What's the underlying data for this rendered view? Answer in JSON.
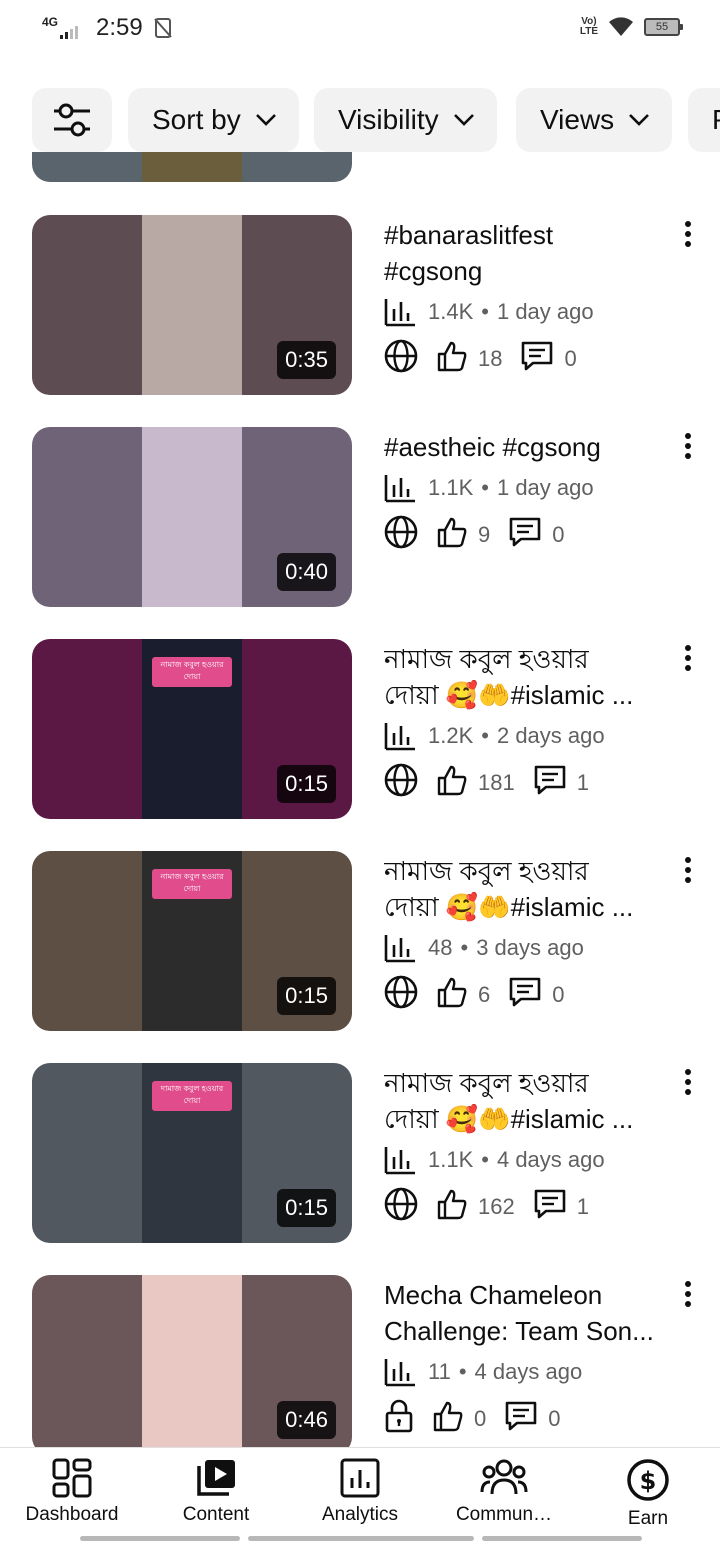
{
  "status_bar": {
    "time": "2:59",
    "network": "4G",
    "volte_top": "Vo)",
    "volte_bottom": "LTE",
    "battery": "55"
  },
  "filters": {
    "chips": [
      {
        "label": "Sort by"
      },
      {
        "label": "Visibility"
      },
      {
        "label": "Views"
      },
      {
        "label": "P"
      }
    ]
  },
  "videos": [
    {
      "title_lines": [
        "#banaraslitfest",
        "#cgsong"
      ],
      "views": "1.4K",
      "age": "1 day ago",
      "likes": "18",
      "comments": "0",
      "duration": "0:35",
      "visibility_icon": "globe-icon",
      "bg": "#5d4c52",
      "portrait_bg": "#b8a9a4"
    },
    {
      "title_lines": [
        "#aestheic #cgsong"
      ],
      "views": "1.1K",
      "age": "1 day ago",
      "likes": "9",
      "comments": "0",
      "duration": "0:40",
      "visibility_icon": "globe-icon",
      "bg": "#6f6477",
      "portrait_bg": "#c9b9cc"
    },
    {
      "title_lines": [
        "নামাজ কবুল হওয়ার",
        "দোয়া 🥰🤲#islamic ..."
      ],
      "views": "1.2K",
      "age": "2 days ago",
      "likes": "181",
      "comments": "1",
      "duration": "0:15",
      "visibility_icon": "globe-icon",
      "bg": "#5b1844",
      "portrait_bg": "#1a1d2e",
      "tag": "নামাজ কবুল হওয়ার দোয়া"
    },
    {
      "title_lines": [
        "নামাজ কবুল হওয়ার",
        "দোয়া 🥰🤲#islamic ..."
      ],
      "views": "48",
      "age": "3 days ago",
      "likes": "6",
      "comments": "0",
      "duration": "0:15",
      "visibility_icon": "globe-icon",
      "bg": "#5e4f44",
      "portrait_bg": "#2c2c2c",
      "tag": "নামাজ কবুল হওয়ার দোয়া"
    },
    {
      "title_lines": [
        "নামাজ কবুল হওয়ার",
        "দোয়া 🥰🤲#islamic ..."
      ],
      "views": "1.1K",
      "age": "4 days ago",
      "likes": "162",
      "comments": "1",
      "duration": "0:15",
      "visibility_icon": "globe-icon",
      "bg": "#525860",
      "portrait_bg": "#2f3640",
      "tag": "দামাজ কবুল হওয়ার দোয়া"
    },
    {
      "title_lines": [
        "Mecha Chameleon",
        "Challenge: Team Son..."
      ],
      "views": "11",
      "age": "4 days ago",
      "likes": "0",
      "comments": "0",
      "duration": "0:46",
      "visibility_icon": "lock-icon",
      "bg": "#6b575a",
      "portrait_bg": "#e9c8c4"
    }
  ],
  "bottom_nav": [
    {
      "label": "Dashboard",
      "icon": "dashboard-icon"
    },
    {
      "label": "Content",
      "icon": "content-icon"
    },
    {
      "label": "Analytics",
      "icon": "analytics-icon"
    },
    {
      "label": "Commun…",
      "icon": "community-icon"
    },
    {
      "label": "Earn",
      "icon": "earn-icon"
    }
  ]
}
